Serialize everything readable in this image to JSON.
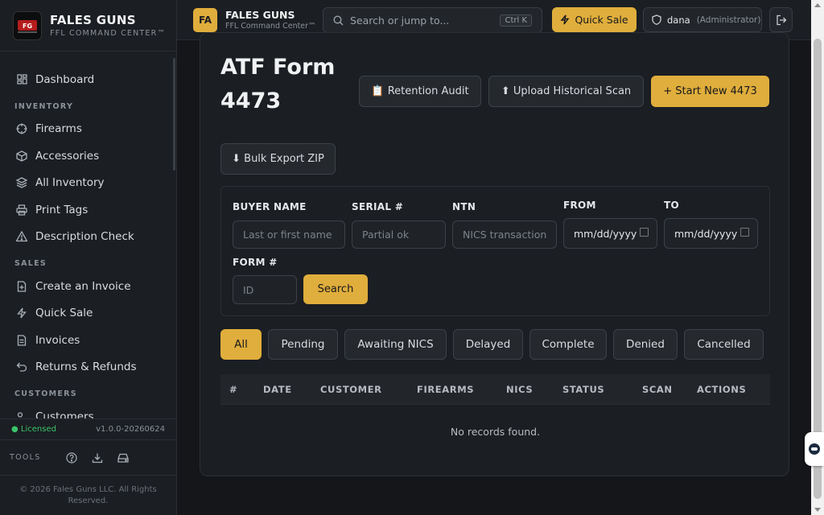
{
  "brand": {
    "name": "FALES GUNS",
    "subtitle": "FFL COMMAND CENTER™"
  },
  "nav": {
    "top": [
      {
        "label": "Dashboard",
        "icon": "dashboard-icon"
      }
    ],
    "sections": [
      {
        "title": "INVENTORY",
        "items": [
          {
            "label": "Firearms",
            "icon": "crosshair-icon"
          },
          {
            "label": "Accessories",
            "icon": "box-icon"
          },
          {
            "label": "All Inventory",
            "icon": "layers-icon"
          },
          {
            "label": "Print Tags",
            "icon": "printer-icon"
          },
          {
            "label": "Description Check",
            "icon": "warning-icon"
          }
        ]
      },
      {
        "title": "SALES",
        "items": [
          {
            "label": "Create an Invoice",
            "icon": "file-plus-icon"
          },
          {
            "label": "Quick Sale",
            "icon": "bolt-icon"
          },
          {
            "label": "Invoices",
            "icon": "document-icon"
          },
          {
            "label": "Returns & Refunds",
            "icon": "return-icon"
          }
        ]
      },
      {
        "title": "CUSTOMERS",
        "items": [
          {
            "label": "Customers",
            "icon": "users-icon"
          }
        ]
      }
    ]
  },
  "license": {
    "status": "● Licensed",
    "version": "v1.0.0-20260624"
  },
  "tools": {
    "label": "TOOLS"
  },
  "copyright": "© 2026 Fales Guns LLC. All Rights Reserved.",
  "topbar": {
    "logo_initials": "FA",
    "title": "FALES GUNS",
    "subtitle": "FFL Command Center™",
    "search_placeholder": "Search or jump to...",
    "search_shortcut": "Ctrl K",
    "quick_sale": "Quick Sale",
    "user_name": "dana",
    "user_role": "(Administrator)"
  },
  "page": {
    "title": "ATF Form 4473",
    "buttons": {
      "retention": "📋 Retention Audit",
      "upload": "⬆ Upload Historical Scan",
      "start_new": "+ Start New 4473",
      "bulk_export": "⬇ Bulk Export ZIP"
    },
    "filters": {
      "buyer_name": {
        "label": "BUYER NAME",
        "placeholder": "Last or first name"
      },
      "serial": {
        "label": "SERIAL #",
        "placeholder": "Partial ok"
      },
      "ntn": {
        "label": "NTN",
        "placeholder": "NICS transaction"
      },
      "from": {
        "label": "FROM",
        "value": "mm/dd/yyyy"
      },
      "to": {
        "label": "TO",
        "value": "mm/dd/yyyy"
      },
      "form_no": {
        "label": "FORM #",
        "placeholder": "ID"
      },
      "search_btn": "Search"
    },
    "status_tabs": [
      "All",
      "Pending",
      "Awaiting NICS",
      "Delayed",
      "Complete",
      "Denied",
      "Cancelled"
    ],
    "active_tab": "All",
    "table": {
      "columns": [
        "#",
        "DATE",
        "CUSTOMER",
        "FIREARMS",
        "NICS",
        "STATUS",
        "SCAN",
        "ACTIONS"
      ],
      "empty_message": "No records found."
    }
  },
  "colors": {
    "accent": "#e0ae3c",
    "licensed": "#3ac36b",
    "background": "#141619",
    "panel": "#1b1e22"
  }
}
